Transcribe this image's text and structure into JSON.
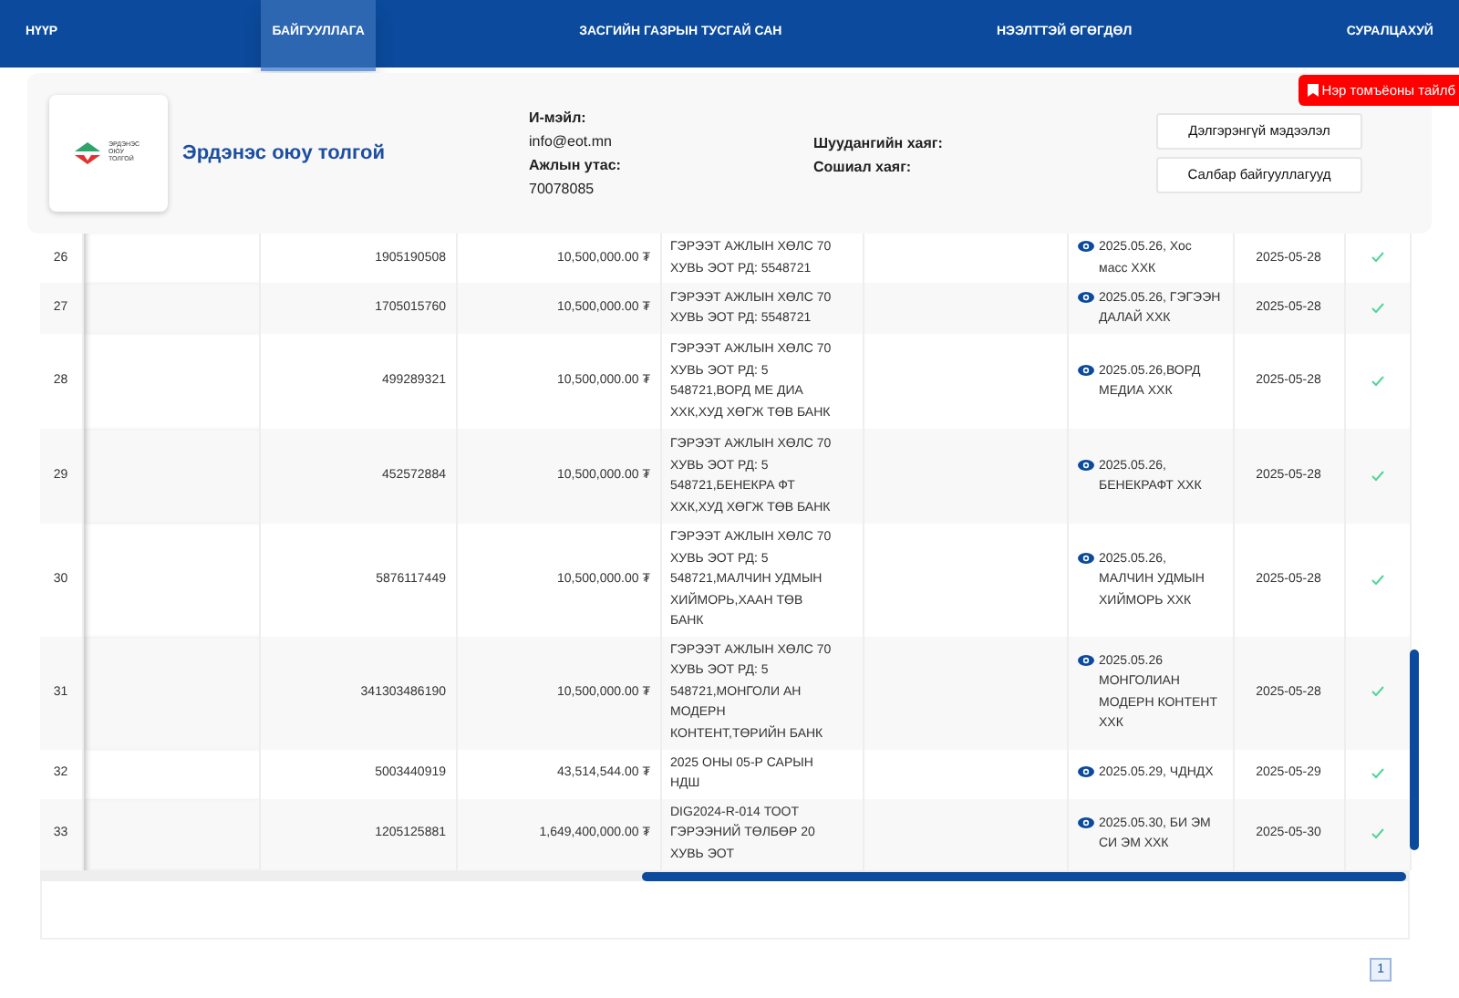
{
  "nav": [
    {
      "label": "НҮҮР",
      "selected": false
    },
    {
      "label": "БАЙГУУЛЛАГА",
      "selected": true
    },
    {
      "label": "ЗАСГИЙН ГАЗРЫН ТУСГАЙ САН",
      "selected": false
    },
    {
      "label": "НЭЭЛТТЭЙ ӨГӨГДӨЛ",
      "selected": false
    },
    {
      "label": "СУРАЛЦАХУЙ",
      "selected": false
    }
  ],
  "glossary_tab": {
    "label": "Нэр томъёоны тайлб"
  },
  "organization": {
    "logo_text": "ЭРДЭНЭС ОЮУ ТОЛГОЙ",
    "name": "Эрдэнэс оюу толгой",
    "contacts": [
      {
        "label": "И-мэйл:",
        "value": "info@eot.mn"
      },
      {
        "label": "Ажлын утас:",
        "value": "70078085"
      }
    ],
    "addresses": [
      {
        "label": "Шуудангийн хаяг:"
      },
      {
        "label": "Сошиал хаяг:"
      }
    ],
    "buttons": [
      "Дэлгэрэнгүй мэдээлэл",
      "Салбар байгууллагууд"
    ]
  },
  "table": {
    "rows": [
      {
        "column_1": "26",
        "column_3": "1905190508",
        "column_4": "10,500,000.00 ₮",
        "column_5": "ГЭРЭЭТ АЖЛЫН ХӨЛС 70 ХУВЬ ЭОТ РД: 5548721",
        "column_7": "2025.05.26, Хос масс ХХК",
        "column_8": "2025-05-28",
        "checked": true
      },
      {
        "column_1": "27",
        "column_3": "1705015760",
        "column_4": "10,500,000.00 ₮",
        "column_5": "ГЭРЭЭТ АЖЛЫН ХӨЛС 70 ХУВЬ ЭОТ РД: 5548721",
        "column_7": "2025.05.26, ГЭГЭЭН ДАЛАЙ ХХК",
        "column_8": "2025-05-28",
        "checked": true
      },
      {
        "column_1": "28",
        "column_3": "499289321",
        "column_4": "10,500,000.00 ₮",
        "column_5": "ГЭРЭЭТ АЖЛЫН ХӨЛС 70 ХУВЬ ЭОТ РД: 5 548721,ВОРД МЕ ДИА ХХК,ХУД ХӨГЖ ТӨВ БАНК",
        "column_7": "2025.05.26,ВОРД МЕДИА ХХК",
        "column_8": "2025-05-28",
        "checked": true
      },
      {
        "column_1": "29",
        "column_3": "452572884",
        "column_4": "10,500,000.00 ₮",
        "column_5": "ГЭРЭЭТ АЖЛЫН ХӨЛС 70 ХУВЬ ЭОТ РД: 5 548721,БЕНЕКРА ФТ ХХК,ХУД ХӨГЖ ТӨВ БАНК",
        "column_7": "2025.05.26, БЕНЕКРАФТ ХХК",
        "column_8": "2025-05-28",
        "checked": true
      },
      {
        "column_1": "30",
        "column_3": "5876117449",
        "column_4": "10,500,000.00 ₮",
        "column_5": "ГЭРЭЭТ АЖЛЫН ХӨЛС 70 ХУВЬ ЭОТ РД: 5 548721,МАЛЧИН УДМЫН ХИЙМОРЬ,ХААН ТӨВ БАНК",
        "column_7": "2025.05.26, МАЛЧИН УДМЫН ХИЙМОРЬ ХХК",
        "column_8": "2025-05-28",
        "checked": true
      },
      {
        "column_1": "31",
        "column_3": "341303486190",
        "column_4": "10,500,000.00 ₮",
        "column_5": "ГЭРЭЭТ АЖЛЫН ХӨЛС 70 ХУВЬ ЭОТ РД: 5 548721,МОНГОЛИ АН МОДЕРН КОНТЕНТ,ТӨРИЙН БАНК",
        "column_7": "2025.05.26 МОНГОЛИАН МОДЕРН КОНТЕНТ ХХК",
        "column_8": "2025-05-28",
        "checked": true
      },
      {
        "column_1": "32",
        "column_3": "5003440919",
        "column_4": "43,514,544.00 ₮",
        "column_5": "2025 ОНЫ 05-Р САРЫН НДШ",
        "column_7": "2025.05.29, ЧДНДХ",
        "column_8": "2025-05-29",
        "checked": true
      },
      {
        "column_1": "33",
        "column_3": "1205125881",
        "column_4": "1,649,400,000.00 ₮",
        "column_5": "DIG2024-R-014 ТООТ ГЭРЭЭНИЙ ТӨЛБӨР 20 ХУВЬ ЭОТ",
        "column_7": "2025.05.30, БИ ЭМ СИ ЭМ ХХК",
        "column_8": "2025-05-30",
        "checked": true
      }
    ]
  },
  "pagination": [
    {
      "label": "1",
      "selected": true
    }
  ]
}
